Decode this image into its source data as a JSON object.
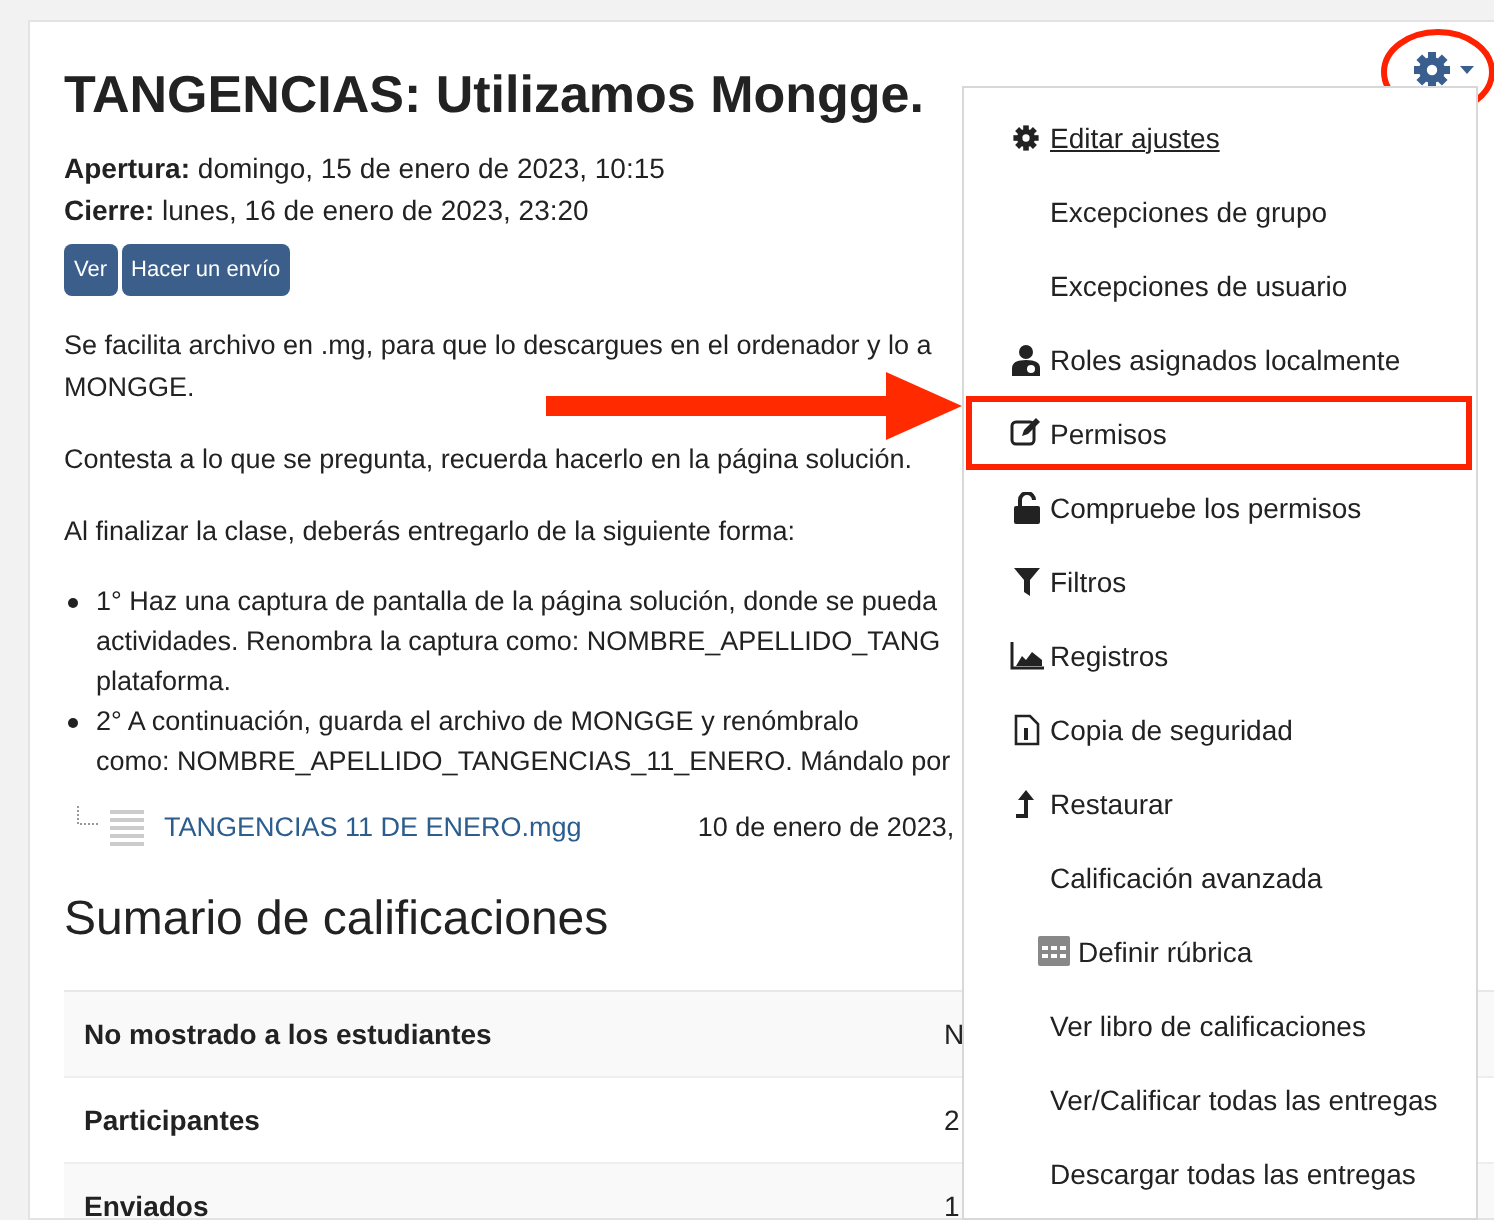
{
  "activity": {
    "title": "TANGENCIAS: Utilizamos Mongge.",
    "dates": [
      {
        "label": "Apertura:",
        "value": "domingo, 15 de enero de 2023, 10:15"
      },
      {
        "label": "Cierre:",
        "value": "lunes, 16 de enero de 2023, 23:20"
      }
    ],
    "buttons": [
      "Ver",
      "Hacer un envío"
    ],
    "paragraphs": [
      {
        "lines": [
          "Se facilita archivo en .mg, para que lo descargues en el ordenador y lo a",
          "MONGGE."
        ]
      },
      {
        "lines": [
          "Contesta a lo que se pregunta, recuerda hacerlo en la página solución."
        ]
      },
      {
        "lines": [
          "Al finalizar la clase, deberás entregarlo de la siguiente forma:"
        ]
      }
    ],
    "bullets": [
      {
        "lines": [
          "1° Haz una captura de pantalla de la página solución, donde se pueda",
          "actividades. Renombra la captura como: NOMBRE_APELLIDO_TANG",
          "plataforma."
        ]
      },
      {
        "lines": [
          "2° A continuación, guarda el archivo de MONGGE y renómbralo",
          "como: NOMBRE_APELLIDO_TANGENCIAS_11_ENERO. Mándalo por"
        ]
      }
    ],
    "file": {
      "name": "TANGENCIAS 11 DE ENERO.mgg",
      "date": "10 de enero de 2023,"
    }
  },
  "summary": {
    "heading": "Sumario de calificaciones",
    "rows": [
      {
        "label": "No mostrado a los estudiantes",
        "value": "N"
      },
      {
        "label": "Participantes",
        "value": "2"
      },
      {
        "label": "Enviados",
        "value": "1"
      }
    ]
  },
  "settings_button": {
    "circled": true
  },
  "menu": {
    "items": [
      {
        "label": "Editar ajustes",
        "kind": "gear",
        "focused": true,
        "highlighted": false
      },
      {
        "label": "Excepciones de grupo",
        "kind": "plain",
        "focused": false,
        "highlighted": false
      },
      {
        "label": "Excepciones de usuario",
        "kind": "plain",
        "focused": false,
        "highlighted": false
      },
      {
        "label": "Roles asignados localmente",
        "kind": "user",
        "focused": false,
        "highlighted": false
      },
      {
        "label": "Permisos",
        "kind": "edit",
        "focused": false,
        "highlighted": true
      },
      {
        "label": "Compruebe los permisos",
        "kind": "lock",
        "focused": false,
        "highlighted": false
      },
      {
        "label": "Filtros",
        "kind": "filter",
        "focused": false,
        "highlighted": false
      },
      {
        "label": "Registros",
        "kind": "chart",
        "focused": false,
        "highlighted": false
      },
      {
        "label": "Copia de seguridad",
        "kind": "file",
        "focused": false,
        "highlighted": false
      },
      {
        "label": "Restaurar",
        "kind": "upload",
        "focused": false,
        "highlighted": false
      },
      {
        "label": "Calificación avanzada",
        "kind": "plain",
        "focused": false,
        "highlighted": false,
        "children": [
          {
            "label": "Definir rúbrica",
            "kind": "table",
            "focused": false,
            "highlighted": false
          }
        ]
      },
      {
        "label": "Ver libro de calificaciones",
        "kind": "plain",
        "focused": false,
        "highlighted": false
      },
      {
        "label": "Ver/Calificar todas las entregas",
        "kind": "plain",
        "focused": false,
        "highlighted": false
      },
      {
        "label": "Descargar todas las entregas",
        "kind": "plain",
        "focused": false,
        "highlighted": false
      }
    ]
  },
  "annotations": [
    {
      "kind": "arrow"
    }
  ]
}
